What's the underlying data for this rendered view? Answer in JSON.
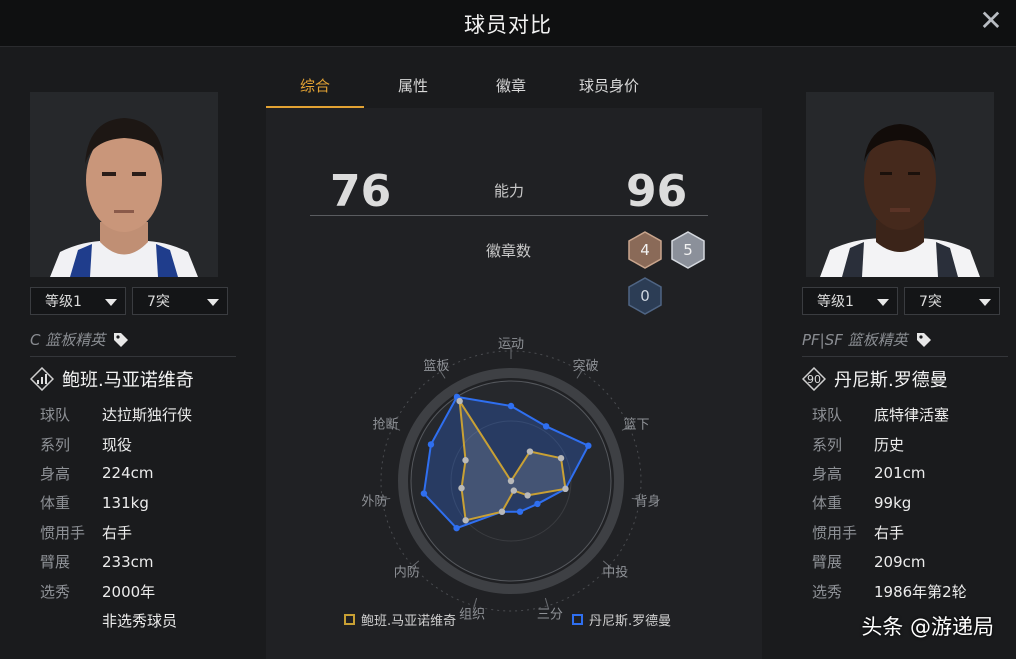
{
  "window": {
    "title": "球员对比"
  },
  "tabs": [
    {
      "label": "综合",
      "active": true
    },
    {
      "label": "属性",
      "active": false
    },
    {
      "label": "徽章",
      "active": false
    },
    {
      "label": "球员身价",
      "active": false
    }
  ],
  "left_player": {
    "level": "等级1",
    "breakthrough": "7突",
    "role": "C 篮板精英",
    "name": "鲍班.马亚诺维奇",
    "info": [
      {
        "key": "球队",
        "value": "达拉斯独行侠"
      },
      {
        "key": "系列",
        "value": "现役"
      },
      {
        "key": "身高",
        "value": "224cm"
      },
      {
        "key": "体重",
        "value": "131kg"
      },
      {
        "key": "惯用手",
        "value": "右手"
      },
      {
        "key": "臂展",
        "value": "233cm"
      },
      {
        "key": "选秀",
        "value": "2000年"
      },
      {
        "key": "",
        "value": "非选秀球员"
      }
    ]
  },
  "right_player": {
    "level": "等级1",
    "breakthrough": "7突",
    "role": "PF|SF 篮板精英",
    "badge_number": "90",
    "name": "丹尼斯.罗德曼",
    "info": [
      {
        "key": "球队",
        "value": "底特律活塞"
      },
      {
        "key": "系列",
        "value": "历史"
      },
      {
        "key": "身高",
        "value": "201cm"
      },
      {
        "key": "体重",
        "value": "99kg"
      },
      {
        "key": "惯用手",
        "value": "右手"
      },
      {
        "key": "臂展",
        "value": "209cm"
      },
      {
        "key": "选秀",
        "value": "1986年第2轮"
      }
    ]
  },
  "comparison": {
    "ability_label": "能力",
    "left_ability": "76",
    "right_ability": "96",
    "badge_count_label": "徽章数",
    "badge_counts": {
      "bronze": "4",
      "silver": "5",
      "gold": "0"
    }
  },
  "radar": {
    "axes": [
      "运动",
      "突破",
      "篮下",
      "背身",
      "中投",
      "三分",
      "组织",
      "内防",
      "外防",
      "抢断",
      "篮板"
    ],
    "series": [
      {
        "name": "鲍班.马亚诺维奇",
        "color": "#c8a034",
        "values": [
          0.0,
          0.35,
          0.55,
          0.55,
          0.22,
          0.1,
          0.32,
          0.6,
          0.5,
          0.5,
          0.95
        ]
      },
      {
        "name": "丹尼斯.罗德曼",
        "color": "#2f6ff0",
        "values": [
          0.75,
          0.65,
          0.85,
          0.55,
          0.35,
          0.32,
          0.32,
          0.72,
          0.88,
          0.88,
          1.0
        ]
      }
    ]
  },
  "watermark": "头条 @游递局"
}
